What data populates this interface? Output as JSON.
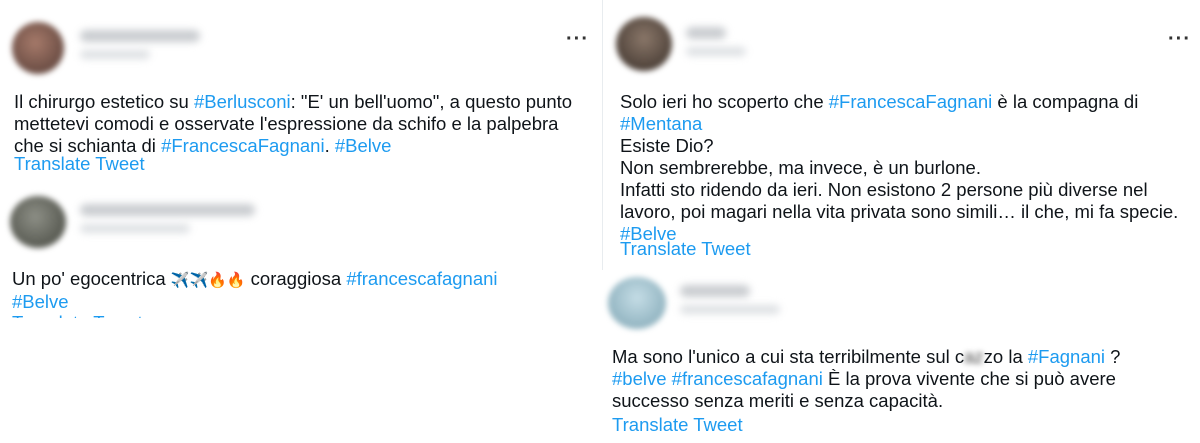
{
  "colors": {
    "hashtag": "#1d9bf0",
    "text": "#0f1419"
  },
  "tweets": [
    {
      "id": "tweet-1",
      "more_label": "···",
      "line1_pre": "Il chirurgo estetico su ",
      "line1_tag": "#Berlusconi",
      "line1_post": ": \"E' un bell'uomo\", a questo punto",
      "line2": "mettetevi comodi e osservate l'espressione da schifo e la palpebra",
      "line3_pre": "che si schianta di ",
      "line3_tag1": "#FrancescaFagnani",
      "line3_sep": ". ",
      "line3_tag2": "#Belve",
      "translate": "Translate Tweet"
    },
    {
      "id": "tweet-2",
      "line1_pre": "Un po' egocentrica ",
      "emojis": "✈️✈️🔥🔥",
      "line1_mid": " coraggiosa ",
      "line1_tag": "#francescafagnani",
      "line2_tag": "#Belve",
      "translate": "Translate Tweet"
    },
    {
      "id": "tweet-3",
      "more_label": "···",
      "line1_pre": "Solo ieri ho scoperto che ",
      "line1_tag": "#FrancescaFagnani",
      "line1_post": " è la compagna di",
      "line2_tag": "#Mentana",
      "line3": "Esiste Dio?",
      "line4": "Non sembrerebbe, ma invece, è un burlone.",
      "line5": "Infatti sto ridendo da ieri. Non esistono 2 persone più diverse nel",
      "line6": "lavoro, poi magari nella vita privata sono simili… il che, mi fa specie.",
      "line7_tag": "#Belve",
      "translate": "Translate Tweet"
    },
    {
      "id": "tweet-4",
      "line1_pre": "Ma sono l'unico a cui sta terribilmente sul c",
      "line1_censored": "az",
      "line1_mid": "zo la ",
      "line1_tag": "#Fagnani",
      "line1_post": " ?",
      "line2_tag1": "#belve",
      "line2_tag2": "#francescafagnani",
      "line2_post": " È la prova vivente che si può avere",
      "line3": "successo senza meriti e senza capacità.",
      "translate": "Translate Tweet"
    }
  ]
}
